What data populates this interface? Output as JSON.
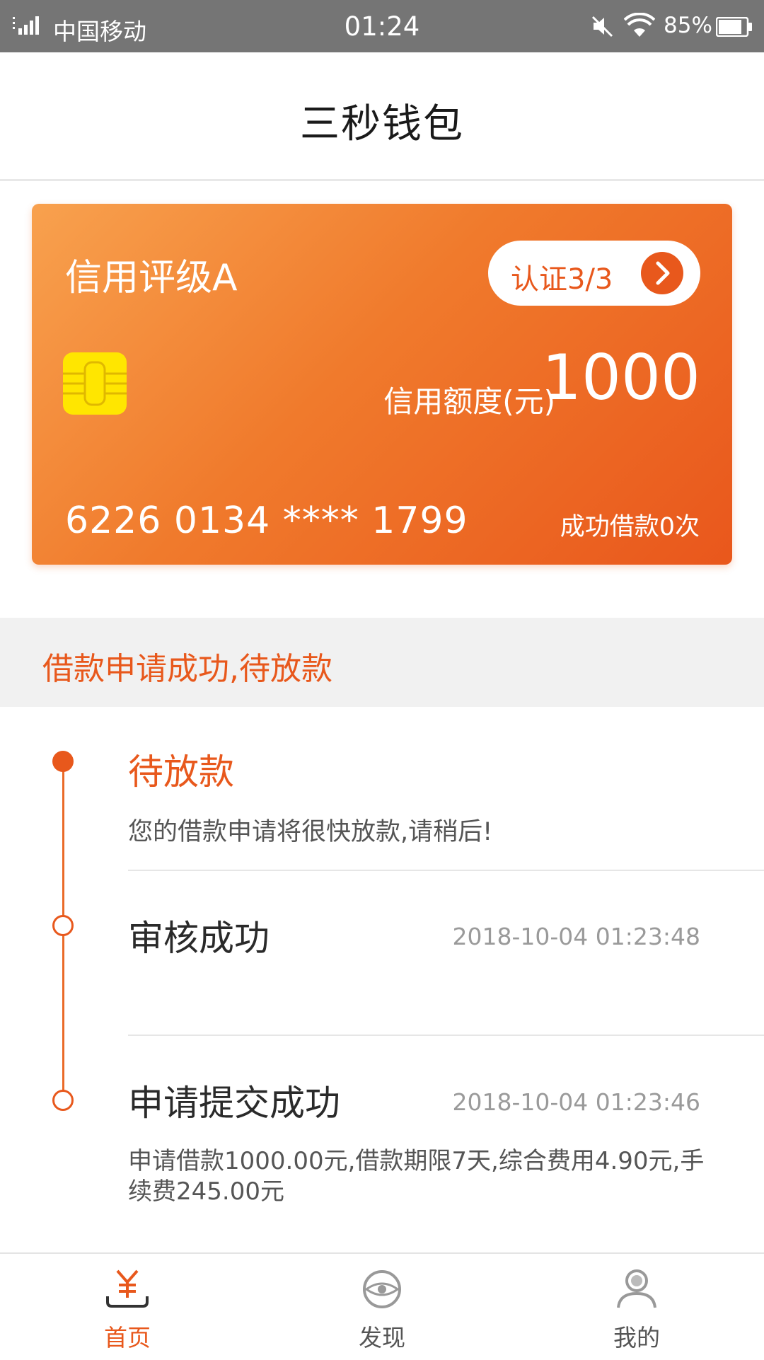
{
  "status_bar": {
    "carrier": "中国移动",
    "time": "01:24",
    "battery": "85%",
    "battery_level": 0.85
  },
  "header": {
    "title": "三秒钱包"
  },
  "card": {
    "rating": "信用评级A",
    "auth_label": "认证3/3",
    "limit_label": "信用额度(元)",
    "limit_value": "1000",
    "card_number": "6226 0134 **** 1799",
    "loan_count": "成功借款0次"
  },
  "banner": {
    "text": "借款申请成功,待放款"
  },
  "timeline": [
    {
      "title": "待放款",
      "desc": "您的借款申请将很快放款,请稍后!",
      "time": ""
    },
    {
      "title": "审核成功",
      "desc": "",
      "time": "2018-10-04 01:23:48"
    },
    {
      "title": "申请提交成功",
      "desc_line1": "申请借款1000.00元,借款期限7天,综合费用4.90元,手",
      "desc_line2": "续费245.00元",
      "time": "2018-10-04 01:23:46"
    }
  ],
  "bottom_nav": {
    "items": [
      {
        "label": "首页",
        "icon": "yuan-icon",
        "active": true
      },
      {
        "label": "发现",
        "icon": "eye-icon",
        "active": false
      },
      {
        "label": "我的",
        "icon": "user-icon",
        "active": false
      }
    ]
  },
  "colors": {
    "accent": "#e8581c",
    "card_gradient_start": "#f8a14e",
    "card_gradient_end": "#e9571c",
    "status_bar": "#757575"
  }
}
